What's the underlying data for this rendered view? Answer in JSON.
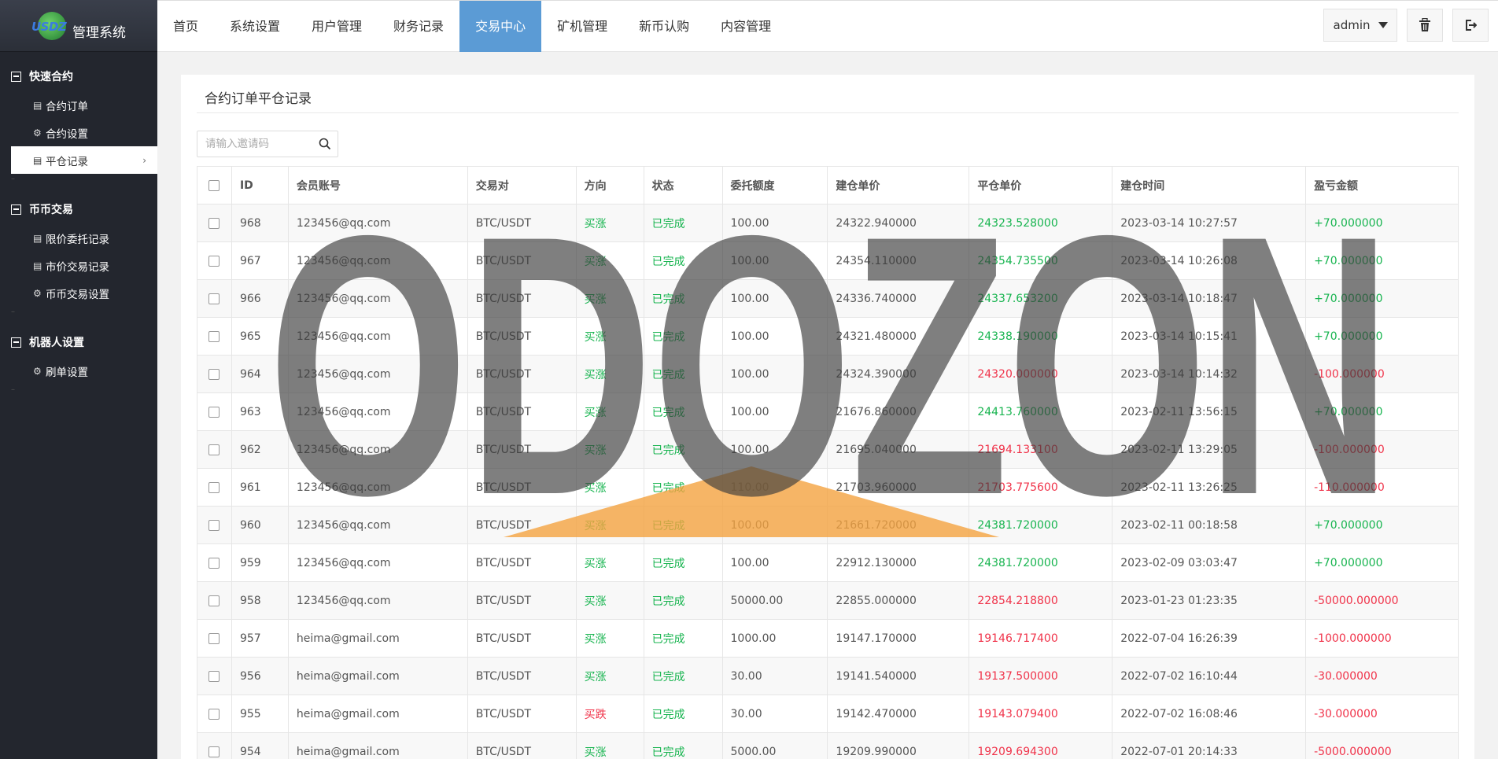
{
  "sidebar": {
    "logo_mark": "USDZ",
    "logo_title": "管理系统",
    "groups": [
      {
        "title": "快速合约",
        "items": [
          {
            "icon": "doc-icon",
            "label": "合约订单"
          },
          {
            "icon": "gear-icon",
            "label": "合约设置"
          },
          {
            "icon": "doc-icon",
            "label": "平仓记录"
          }
        ]
      },
      {
        "title": "币币交易",
        "items": [
          {
            "icon": "doc-icon",
            "label": "限价委托记录"
          },
          {
            "icon": "doc-icon",
            "label": "市价交易记录"
          },
          {
            "icon": "gear-icon",
            "label": "币币交易设置"
          }
        ]
      },
      {
        "title": "机器人设置",
        "items": [
          {
            "icon": "gear-icon",
            "label": "刷单设置"
          }
        ]
      }
    ],
    "active_item": "平仓记录"
  },
  "topbar": {
    "nav": [
      "首页",
      "系统设置",
      "用户管理",
      "财务记录",
      "交易中心",
      "矿机管理",
      "新币认购",
      "内容管理"
    ],
    "active_nav": "交易中心",
    "admin_label": "admin"
  },
  "panel": {
    "title": "合约订单平仓记录",
    "search_placeholder": "请输入邀请码"
  },
  "table": {
    "headers": [
      "ID",
      "会员账号",
      "交易对",
      "方向",
      "状态",
      "委托额度",
      "建仓单价",
      "平仓单价",
      "建仓时间",
      "盈亏金额"
    ],
    "rows": [
      {
        "id": "968",
        "account": "123456@qq.com",
        "pair": "BTC/USDT",
        "dir": "买涨",
        "status": "已完成",
        "amount": "100.00",
        "open": "24322.940000",
        "close": "24323.528000",
        "close_color": "green",
        "time": "2023-03-14 10:27:57",
        "pnl": "+70.000000",
        "pnl_color": "green"
      },
      {
        "id": "967",
        "account": "123456@qq.com",
        "pair": "BTC/USDT",
        "dir": "买涨",
        "status": "已完成",
        "amount": "100.00",
        "open": "24354.110000",
        "close": "24354.735500",
        "close_color": "green",
        "time": "2023-03-14 10:26:08",
        "pnl": "+70.000000",
        "pnl_color": "green"
      },
      {
        "id": "966",
        "account": "123456@qq.com",
        "pair": "BTC/USDT",
        "dir": "买涨",
        "status": "已完成",
        "amount": "100.00",
        "open": "24336.740000",
        "close": "24337.653200",
        "close_color": "green",
        "time": "2023-03-14 10:18:47",
        "pnl": "+70.000000",
        "pnl_color": "green"
      },
      {
        "id": "965",
        "account": "123456@qq.com",
        "pair": "BTC/USDT",
        "dir": "买涨",
        "status": "已完成",
        "amount": "100.00",
        "open": "24321.480000",
        "close": "24338.190000",
        "close_color": "green",
        "time": "2023-03-14 10:15:41",
        "pnl": "+70.000000",
        "pnl_color": "green"
      },
      {
        "id": "964",
        "account": "123456@qq.com",
        "pair": "BTC/USDT",
        "dir": "买涨",
        "status": "已完成",
        "amount": "100.00",
        "open": "24324.390000",
        "close": "24320.000000",
        "close_color": "red",
        "time": "2023-03-14 10:14:32",
        "pnl": "-100.000000",
        "pnl_color": "red"
      },
      {
        "id": "963",
        "account": "123456@qq.com",
        "pair": "BTC/USDT",
        "dir": "买涨",
        "status": "已完成",
        "amount": "100.00",
        "open": "21676.860000",
        "close": "24413.760000",
        "close_color": "green",
        "time": "2023-02-11 13:56:15",
        "pnl": "+70.000000",
        "pnl_color": "green"
      },
      {
        "id": "962",
        "account": "123456@qq.com",
        "pair": "BTC/USDT",
        "dir": "买涨",
        "status": "已完成",
        "amount": "100.00",
        "open": "21695.040000",
        "close": "21694.133100",
        "close_color": "red",
        "time": "2023-02-11 13:29:05",
        "pnl": "-100.000000",
        "pnl_color": "red"
      },
      {
        "id": "961",
        "account": "123456@qq.com",
        "pair": "BTC/USDT",
        "dir": "买涨",
        "status": "已完成",
        "amount": "110.00",
        "open": "21703.960000",
        "close": "21703.775600",
        "close_color": "red",
        "time": "2023-02-11 13:26:25",
        "pnl": "-110.000000",
        "pnl_color": "red"
      },
      {
        "id": "960",
        "account": "123456@qq.com",
        "pair": "BTC/USDT",
        "dir": "买涨",
        "status": "已完成",
        "amount": "100.00",
        "open": "21661.720000",
        "close": "24381.720000",
        "close_color": "green",
        "time": "2023-02-11 00:18:58",
        "pnl": "+70.000000",
        "pnl_color": "green"
      },
      {
        "id": "959",
        "account": "123456@qq.com",
        "pair": "BTC/USDT",
        "dir": "买涨",
        "status": "已完成",
        "amount": "100.00",
        "open": "22912.130000",
        "close": "24381.720000",
        "close_color": "green",
        "time": "2023-02-09 03:03:47",
        "pnl": "+70.000000",
        "pnl_color": "green"
      },
      {
        "id": "958",
        "account": "123456@qq.com",
        "pair": "BTC/USDT",
        "dir": "买涨",
        "status": "已完成",
        "amount": "50000.00",
        "open": "22855.000000",
        "close": "22854.218800",
        "close_color": "red",
        "time": "2023-01-23 01:23:35",
        "pnl": "-50000.000000",
        "pnl_color": "red"
      },
      {
        "id": "957",
        "account": "heima@gmail.com",
        "pair": "BTC/USDT",
        "dir": "买涨",
        "status": "已完成",
        "amount": "1000.00",
        "open": "19147.170000",
        "close": "19146.717400",
        "close_color": "red",
        "time": "2022-07-04 16:26:39",
        "pnl": "-1000.000000",
        "pnl_color": "red"
      },
      {
        "id": "956",
        "account": "heima@gmail.com",
        "pair": "BTC/USDT",
        "dir": "买涨",
        "status": "已完成",
        "amount": "30.00",
        "open": "19141.540000",
        "close": "19137.500000",
        "close_color": "red",
        "time": "2022-07-02 16:10:44",
        "pnl": "-30.000000",
        "pnl_color": "red"
      },
      {
        "id": "955",
        "account": "heima@gmail.com",
        "pair": "BTC/USDT",
        "dir": "买跌",
        "dir_color": "red",
        "status": "已完成",
        "amount": "30.00",
        "open": "19142.470000",
        "close": "19143.079400",
        "close_color": "red",
        "time": "2022-07-02 16:08:46",
        "pnl": "-30.000000",
        "pnl_color": "red"
      },
      {
        "id": "954",
        "account": "heima@gmail.com",
        "pair": "BTC/USDT",
        "dir": "买涨",
        "status": "已完成",
        "amount": "5000.00",
        "open": "19209.990000",
        "close": "19209.694300",
        "close_color": "red",
        "time": "2022-07-01 20:14:33",
        "pnl": "-5000.000000",
        "pnl_color": "red"
      }
    ]
  },
  "watermark": {
    "text": "ODOZON"
  },
  "colors": {
    "accent": "#5b9bd5",
    "sidebar_bg": "#23262e",
    "green": "#17b44f",
    "red": "#f0334a",
    "watermark_orange": "#f4a340"
  }
}
